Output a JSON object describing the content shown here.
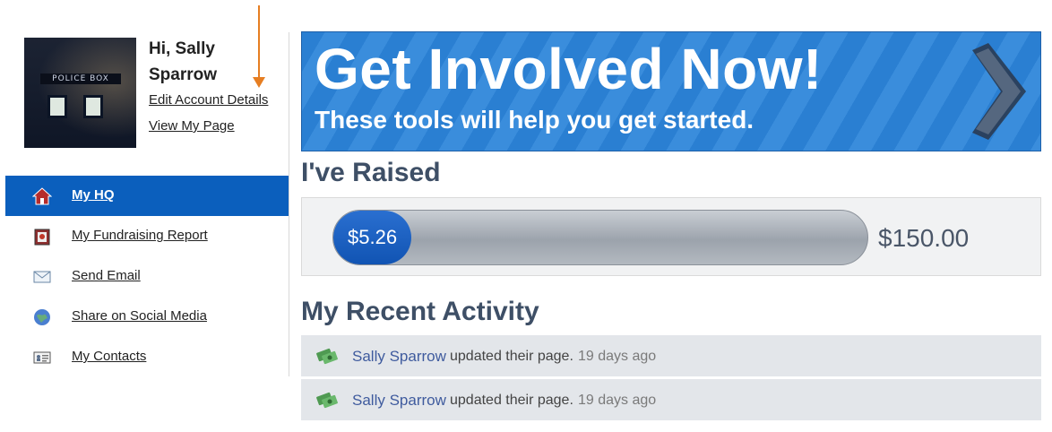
{
  "profile": {
    "greeting": "Hi, Sally Sparrow",
    "edit_link": "Edit Account Details",
    "view_link": "View My Page",
    "avatar_text": "POLICE BOX"
  },
  "nav": {
    "items": [
      {
        "label": "My HQ",
        "icon": "home-icon",
        "active": true
      },
      {
        "label": "My Fundraising Report",
        "icon": "report-icon",
        "active": false
      },
      {
        "label": "Send Email",
        "icon": "email-icon",
        "active": false
      },
      {
        "label": "Share on Social Media",
        "icon": "globe-icon",
        "active": false
      },
      {
        "label": "My Contacts",
        "icon": "contacts-icon",
        "active": false
      }
    ]
  },
  "banner": {
    "title": "Get Involved Now!",
    "subtitle": "These tools will help you get started.",
    "icon": "chevron-right-icon"
  },
  "raised": {
    "title": "I've Raised",
    "amount": "$5.26",
    "goal": "$150.00",
    "progress_fraction": 0.035
  },
  "activity": {
    "title": "My Recent Activity",
    "items": [
      {
        "who": "Sally Sparrow",
        "what": "updated their page.",
        "when": "19 days ago",
        "icon": "money-icon"
      },
      {
        "who": "Sally Sparrow",
        "what": "updated their page.",
        "when": "19 days ago",
        "icon": "money-icon"
      }
    ]
  },
  "colors": {
    "nav_active": "#0b5fbd",
    "banner_blue": "#2a7fd2",
    "heading": "#3e4f66",
    "arrow_annotation": "#e67e22"
  }
}
